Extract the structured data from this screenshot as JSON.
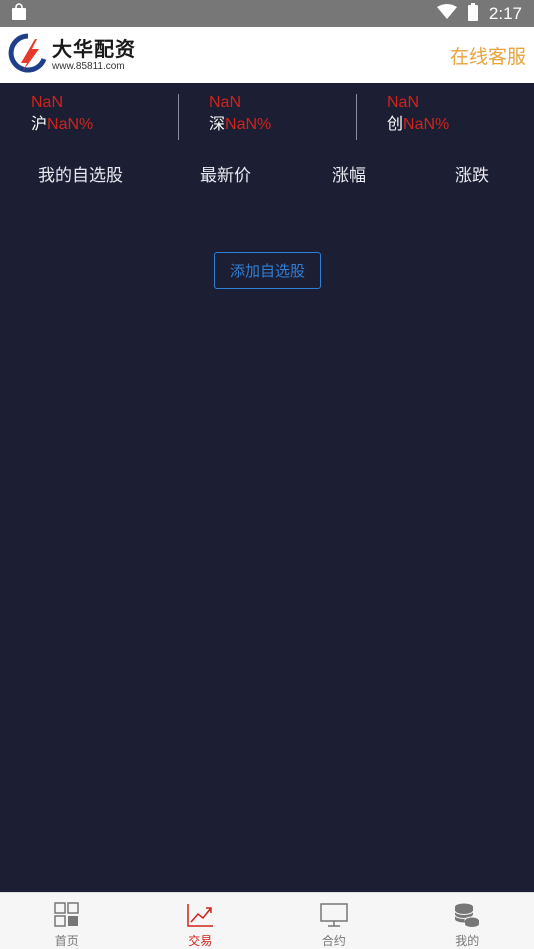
{
  "status_bar": {
    "time": "2:17"
  },
  "header": {
    "logo_title": "大华配资",
    "logo_url_text": "www.85811.com",
    "service_label": "在线客服"
  },
  "indices": [
    {
      "value": "NaN",
      "name": "沪",
      "percent": "NaN%"
    },
    {
      "value": "NaN",
      "name": "深",
      "percent": "NaN%"
    },
    {
      "value": "NaN",
      "name": "创",
      "percent": "NaN%"
    }
  ],
  "columns": {
    "my_stocks": "我的自选股",
    "latest_price": "最新价",
    "change_pct": "涨幅",
    "change": "涨跌"
  },
  "add_stock_label": "添加自选股",
  "nav": {
    "items": [
      {
        "label": "首页",
        "icon": "grid-icon",
        "active": false
      },
      {
        "label": "交易",
        "icon": "chart-trend-icon",
        "active": true
      },
      {
        "label": "合约",
        "icon": "monitor-icon",
        "active": false
      },
      {
        "label": "我的",
        "icon": "coins-stack-icon",
        "active": false
      }
    ]
  },
  "colors": {
    "background": "#1c1e33",
    "accent_red": "#d0231c",
    "service_orange": "#e8a33d",
    "button_blue": "#2f7fd6"
  }
}
